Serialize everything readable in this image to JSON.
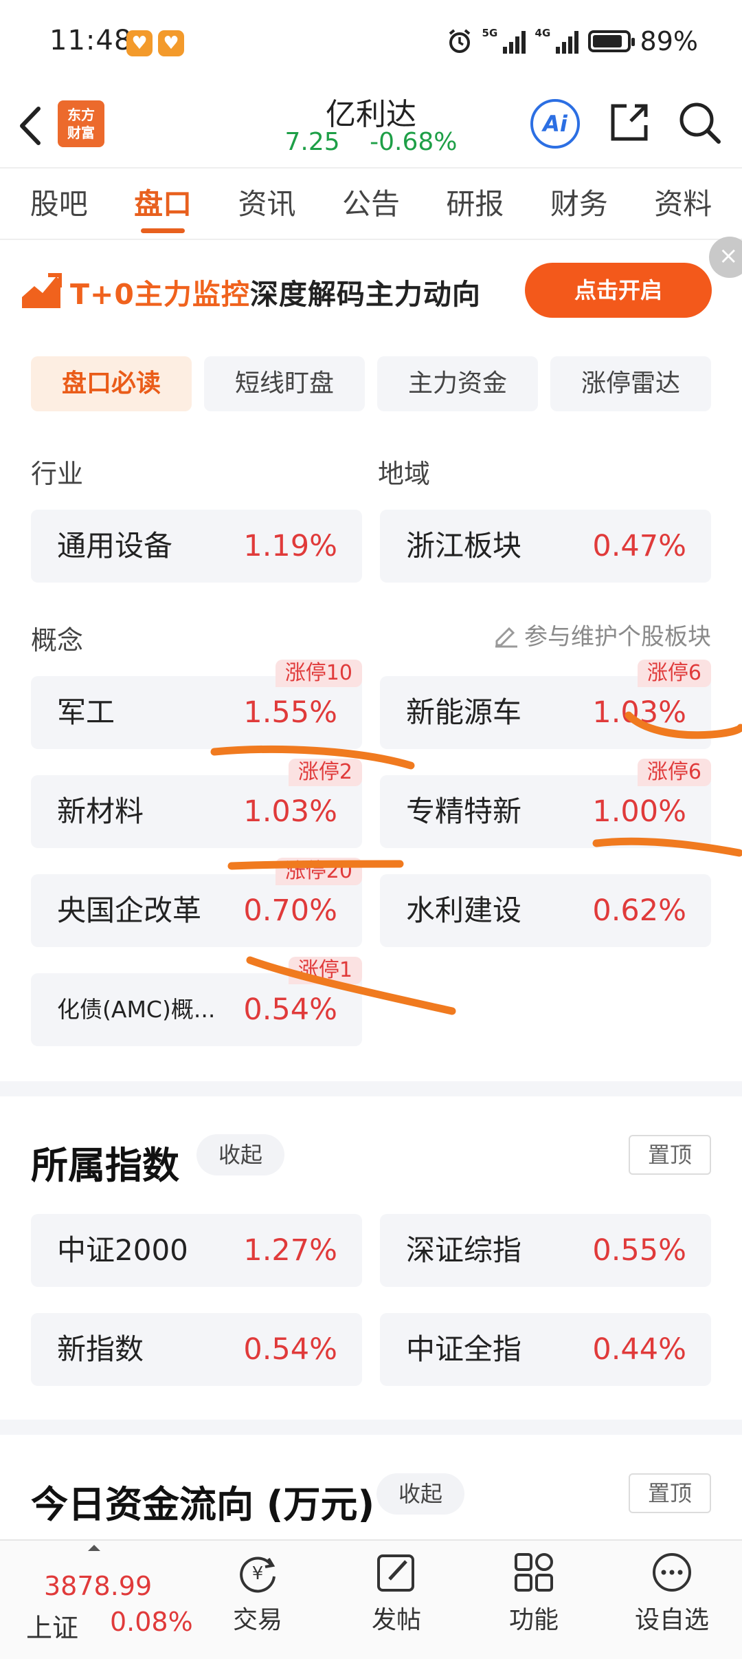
{
  "status_bar": {
    "time": "11:48",
    "net1": "5G",
    "net2": "4G",
    "battery": "89%",
    "battery_level": 0.89
  },
  "header": {
    "logo_text_line1": "东方",
    "logo_text_line2": "财富",
    "title": "亿利达",
    "price": "7.25",
    "change": "-0.68%",
    "ai_label": "Ai"
  },
  "tabs": [
    "股吧",
    "盘口",
    "资讯",
    "公告",
    "研报",
    "财务",
    "资料"
  ],
  "banner": {
    "highlight": "T+0主力监控",
    "text": "深度解码主力动向",
    "button": "点击开启"
  },
  "subtabs": [
    "盘口必读",
    "短线盯盘",
    "主力资金",
    "涨停雷达"
  ],
  "industry": {
    "label": "行业",
    "name": "通用设备",
    "pct": "1.19%"
  },
  "region": {
    "label": "地域",
    "name": "浙江板块",
    "pct": "0.47%"
  },
  "concept": {
    "label": "概念",
    "edit_link": "参与维护个股板块",
    "items": [
      {
        "name": "军工",
        "pct": "1.55%",
        "badge": "涨停10"
      },
      {
        "name": "新能源车",
        "pct": "1.03%",
        "badge": "涨停6"
      },
      {
        "name": "新材料",
        "pct": "1.03%",
        "badge": "涨停2"
      },
      {
        "name": "专精特新",
        "pct": "1.00%",
        "badge": "涨停6"
      },
      {
        "name": "央国企改革",
        "pct": "0.70%",
        "badge": "涨停20"
      },
      {
        "name": "水利建设",
        "pct": "0.62%",
        "badge": ""
      },
      {
        "name": "化债(AMC)概...",
        "pct": "0.54%",
        "badge": "涨停1"
      }
    ]
  },
  "indices": {
    "title": "所属指数",
    "collapse": "收起",
    "pin": "置顶",
    "items": [
      {
        "name": "中证2000",
        "pct": "1.27%"
      },
      {
        "name": "深证综指",
        "pct": "0.55%"
      },
      {
        "name": "新指数",
        "pct": "0.54%"
      },
      {
        "name": "中证全指",
        "pct": "0.44%"
      }
    ]
  },
  "fund_flow": {
    "title": "今日资金流向 (万元)",
    "collapse": "收起",
    "pin": "置顶"
  },
  "bottom_bar": {
    "index_value": "3878.99",
    "index_name": "上证",
    "index_pct": "0.08%",
    "nav": [
      "交易",
      "发帖",
      "功能",
      "设自选"
    ]
  },
  "colors": {
    "accent": "#e8601e",
    "up": "#e03a3a",
    "down": "#1e9f47",
    "annotation": "#f07a1f"
  }
}
